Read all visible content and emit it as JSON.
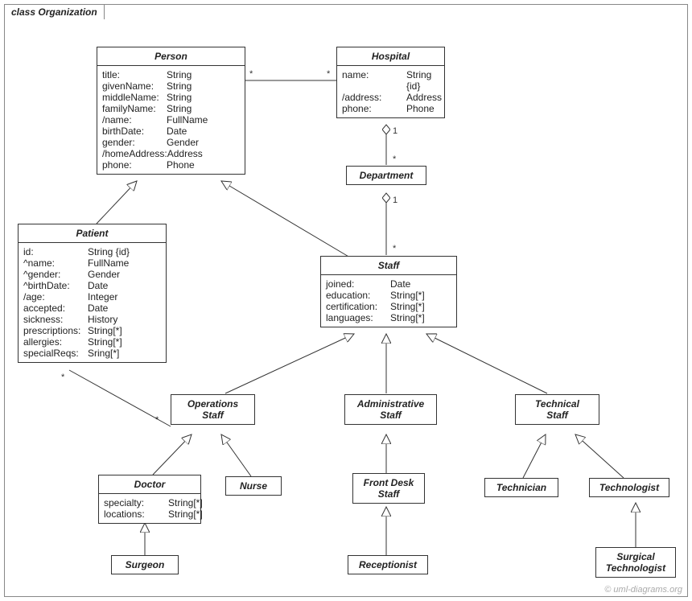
{
  "frame": {
    "label": "class Organization"
  },
  "watermark": "© uml-diagrams.org",
  "classes": {
    "person": {
      "name": "Person",
      "attrs": [
        {
          "n": "title:",
          "t": "String"
        },
        {
          "n": "givenName:",
          "t": "String"
        },
        {
          "n": "middleName:",
          "t": "String"
        },
        {
          "n": "familyName:",
          "t": "String"
        },
        {
          "n": "/name:",
          "t": "FullName"
        },
        {
          "n": "birthDate:",
          "t": "Date"
        },
        {
          "n": "gender:",
          "t": "Gender"
        },
        {
          "n": "/homeAddress:",
          "t": "Address"
        },
        {
          "n": "phone:",
          "t": "Phone"
        }
      ]
    },
    "hospital": {
      "name": "Hospital",
      "attrs": [
        {
          "n": "name:",
          "t": "String {id}"
        },
        {
          "n": "/address:",
          "t": "Address"
        },
        {
          "n": "phone:",
          "t": "Phone"
        }
      ]
    },
    "department": {
      "name": "Department",
      "attrs": []
    },
    "patient": {
      "name": "Patient",
      "attrs": [
        {
          "n": "id:",
          "t": "String {id}"
        },
        {
          "n": "^name:",
          "t": "FullName"
        },
        {
          "n": "^gender:",
          "t": "Gender"
        },
        {
          "n": "^birthDate:",
          "t": "Date"
        },
        {
          "n": "/age:",
          "t": "Integer"
        },
        {
          "n": "accepted:",
          "t": "Date"
        },
        {
          "n": "sickness:",
          "t": "History"
        },
        {
          "n": "prescriptions:",
          "t": "String[*]"
        },
        {
          "n": "allergies:",
          "t": "String[*]"
        },
        {
          "n": "specialReqs:",
          "t": "Sring[*]"
        }
      ]
    },
    "staff": {
      "name": "Staff",
      "attrs": [
        {
          "n": "joined:",
          "t": "Date"
        },
        {
          "n": "education:",
          "t": "String[*]"
        },
        {
          "n": "certification:",
          "t": "String[*]"
        },
        {
          "n": "languages:",
          "t": "String[*]"
        }
      ]
    },
    "opsStaff": {
      "name": "Operations\nStaff",
      "attrs": []
    },
    "admStaff": {
      "name": "Administrative\nStaff",
      "attrs": []
    },
    "techStaff": {
      "name": "Technical\nStaff",
      "attrs": []
    },
    "doctor": {
      "name": "Doctor",
      "attrs": [
        {
          "n": "specialty:",
          "t": "String[*]"
        },
        {
          "n": "locations:",
          "t": "String[*]"
        }
      ]
    },
    "nurse": {
      "name": "Nurse",
      "attrs": []
    },
    "frontDesk": {
      "name": "Front Desk\nStaff",
      "attrs": []
    },
    "technician": {
      "name": "Technician",
      "attrs": []
    },
    "technologist": {
      "name": "Technologist",
      "attrs": []
    },
    "surgeon": {
      "name": "Surgeon",
      "attrs": []
    },
    "receptionist": {
      "name": "Receptionist",
      "attrs": []
    },
    "surgTech": {
      "name": "Surgical\nTechnologist",
      "attrs": []
    }
  },
  "mults": {
    "personHospL": "*",
    "personHospR": "*",
    "hospDept": "1",
    "deptTop": "*",
    "deptStaff": "1",
    "staffTop": "*",
    "patientStar": "*",
    "opsStar": "*"
  }
}
